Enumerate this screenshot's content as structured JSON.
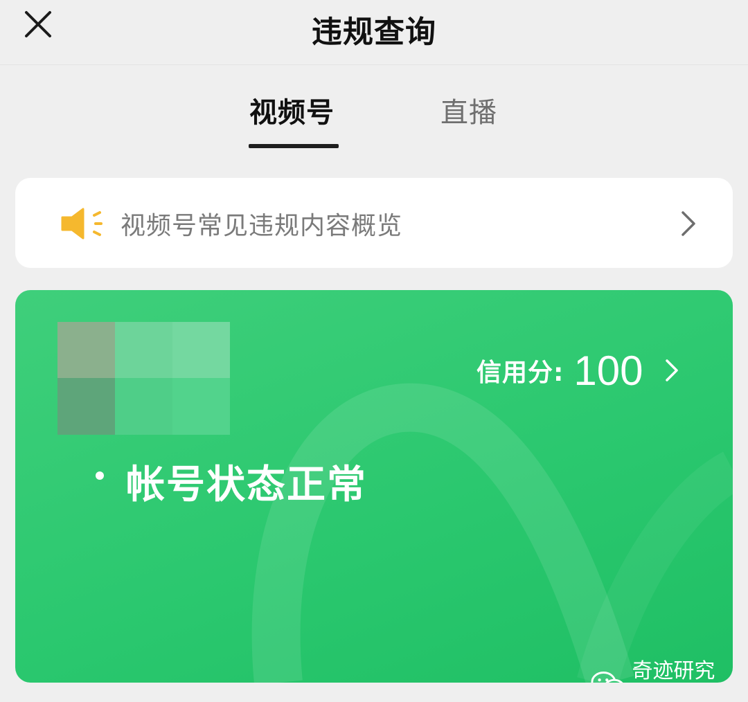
{
  "header": {
    "title": "违规查询",
    "close_icon": "close-icon"
  },
  "tabs": [
    {
      "label": "视频号",
      "active": true
    },
    {
      "label": "直播",
      "active": false
    }
  ],
  "notice": {
    "icon": "megaphone-icon",
    "text": "视频号常见违规内容概览"
  },
  "status_card": {
    "credit_label": "信用分:",
    "credit_value": "100",
    "status_text": "帐号状态正常"
  },
  "watermark": {
    "icon": "wechat-icon",
    "text": "奇迹研究院"
  },
  "colors": {
    "background": "#efefef",
    "card_green": "#2bc86f",
    "megaphone_yellow": "#f5b82e",
    "active_tab": "#111111",
    "inactive_tab": "#6f6f6f"
  }
}
